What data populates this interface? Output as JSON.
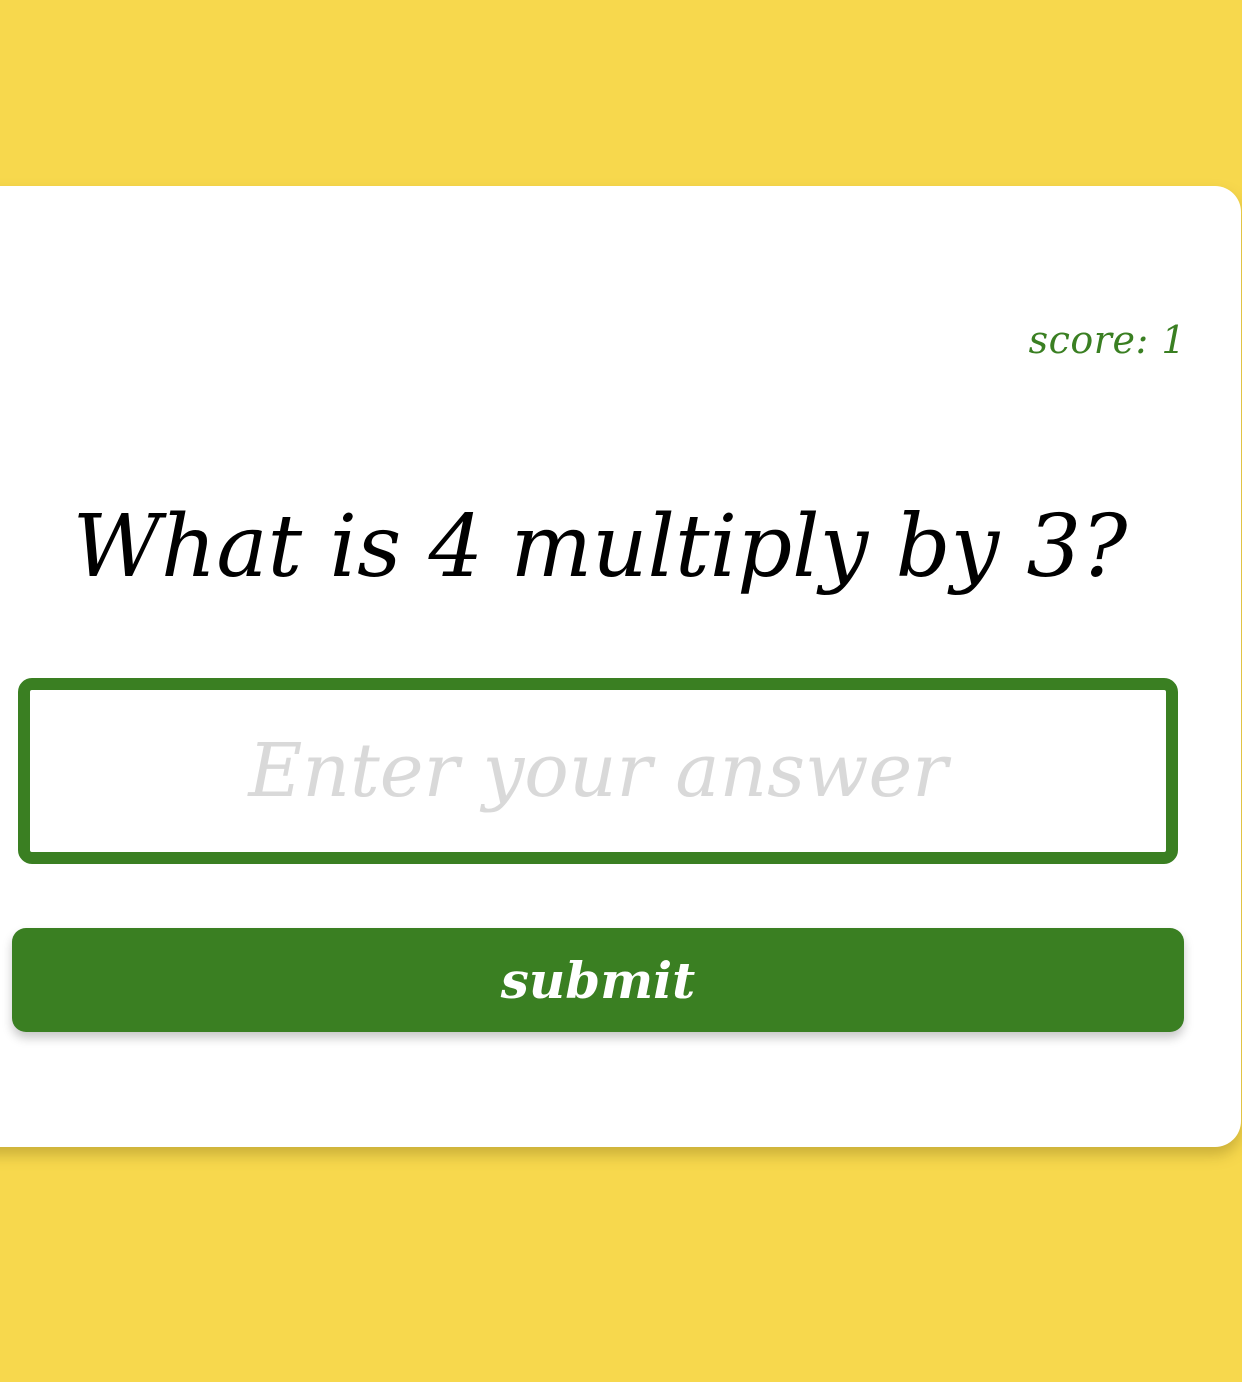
{
  "score": {
    "text": "score: 1"
  },
  "question": {
    "text": "What is 4 multiply by 3?"
  },
  "answer": {
    "value": "",
    "placeholder": "Enter your answer"
  },
  "submit": {
    "label": "submit"
  },
  "colors": {
    "background": "#f7d84d",
    "card": "#ffffff",
    "accent_green": "#3a7f22",
    "question_text": "#000000",
    "placeholder": "#d9d9d9"
  }
}
